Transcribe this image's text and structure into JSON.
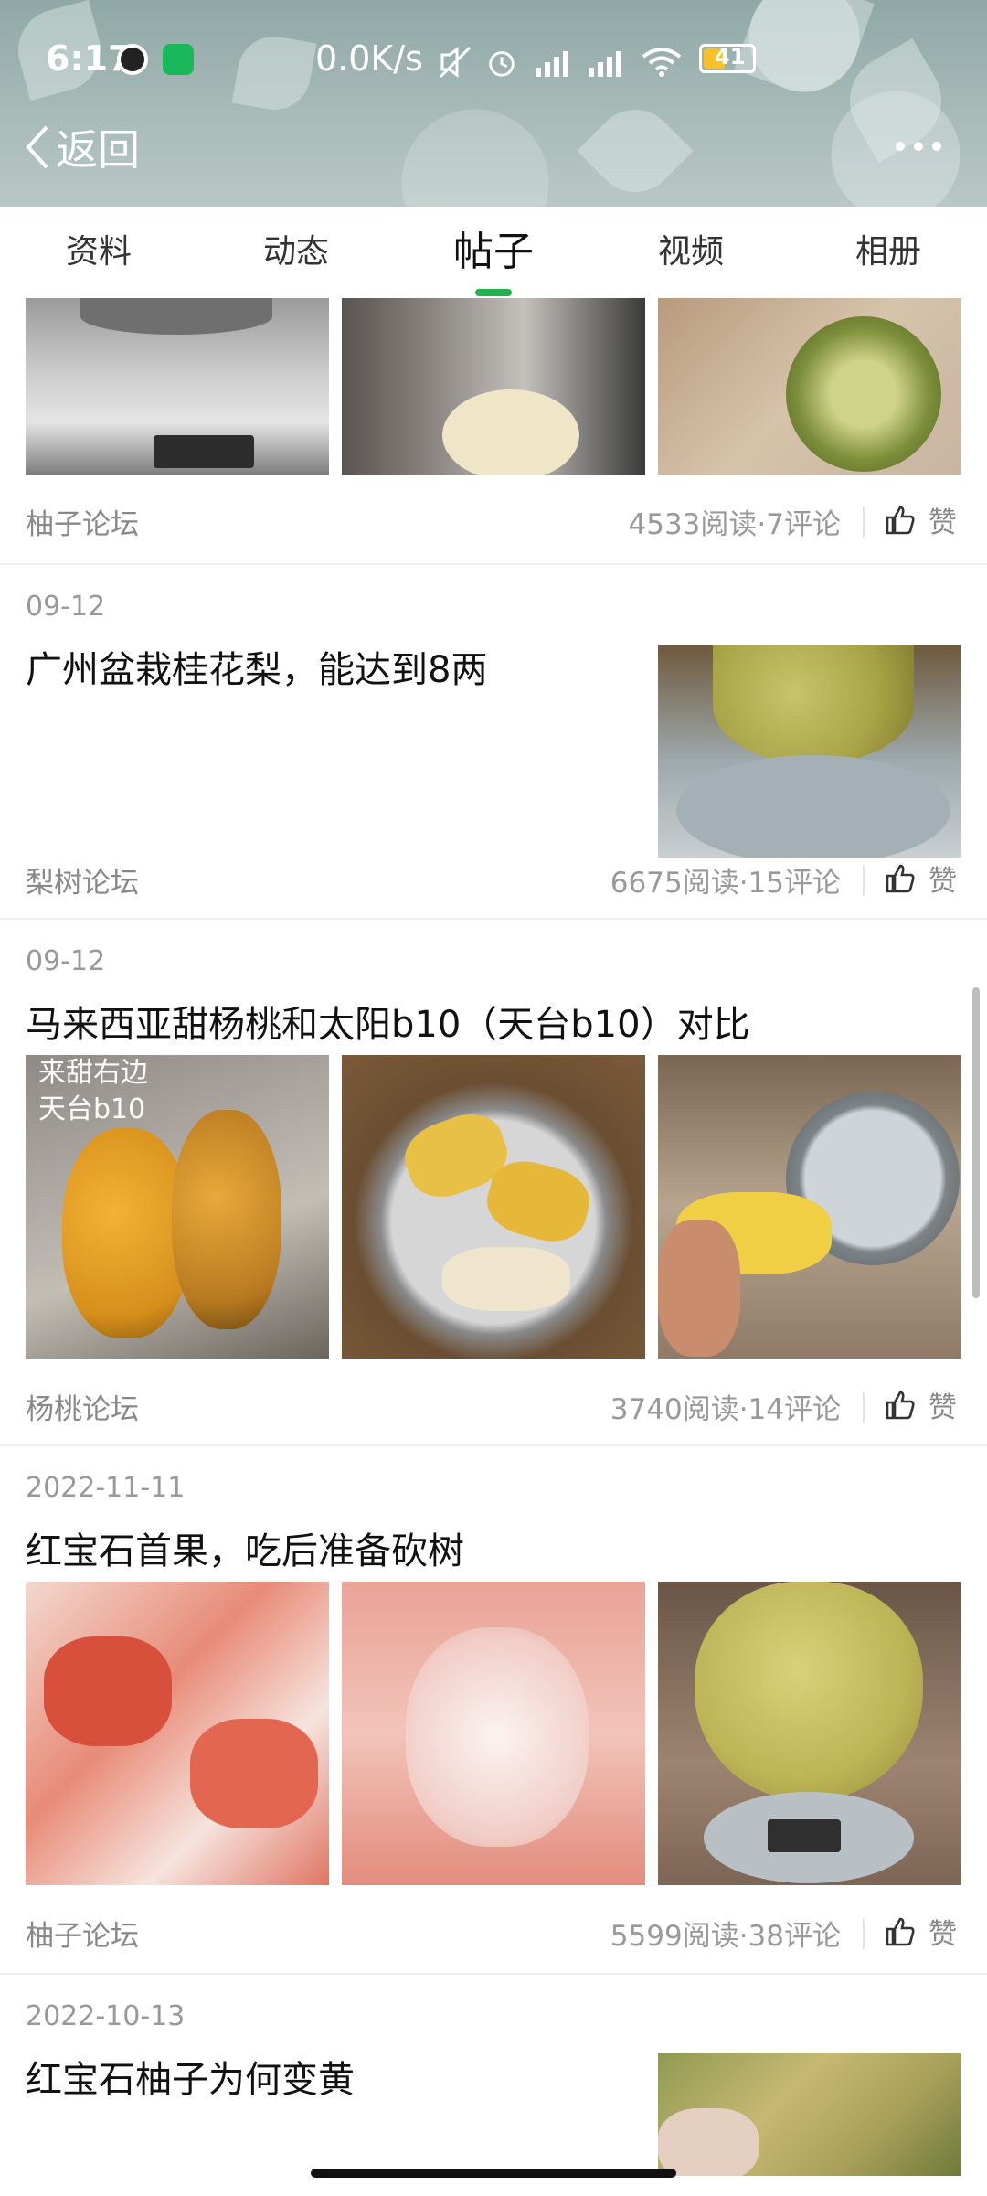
{
  "status_bar": {
    "time": "6:17",
    "net_speed": "0.0K/s",
    "battery": "41",
    "battery_color": "#f6c12a"
  },
  "nav": {
    "back_label": "返回"
  },
  "tabs": [
    {
      "label": "资料"
    },
    {
      "label": "动态"
    },
    {
      "label": "帖子"
    },
    {
      "label": "视频"
    },
    {
      "label": "相册"
    }
  ],
  "active_tab": "帖子",
  "accent_color": "#22b24c",
  "like_label": "赞",
  "posts": [
    {
      "date": "",
      "title": "",
      "forum": "柚子论坛",
      "stats": "4533阅读·7评论",
      "images": [
        "scale-with-pomelo",
        "peeled-pomelo-on-board",
        "cut-pomelo-half"
      ]
    },
    {
      "date": "09-12",
      "title": "广州盆栽桂花梨，能达到8两",
      "forum": "梨树论坛",
      "stats": "6675阅读·15评论",
      "images": [
        "pear-on-scale"
      ]
    },
    {
      "date": "09-12",
      "title": "马来西亚甜杨桃和太阳b10（天台b10）对比",
      "forum": "杨桃论坛",
      "stats": "3740阅读·14评论",
      "images": [
        "starfruit-in-hand",
        "starfruit-in-bowl",
        "starfruit-pieces"
      ],
      "image_caption": "来甜右边\n天台b10"
    },
    {
      "date": "2022-11-11",
      "title": "红宝石首果，吃后准备砍树",
      "forum": "柚子论坛",
      "stats": "5599阅读·38评论",
      "images": [
        "red-pomelo-segments",
        "red-pomelo-peeled",
        "pomelo-on-scale"
      ]
    },
    {
      "date": "2022-10-13",
      "title": "红宝石柚子为何变黄",
      "forum": "",
      "stats": "",
      "images": [
        "yellow-pomelo-closeup"
      ]
    }
  ]
}
